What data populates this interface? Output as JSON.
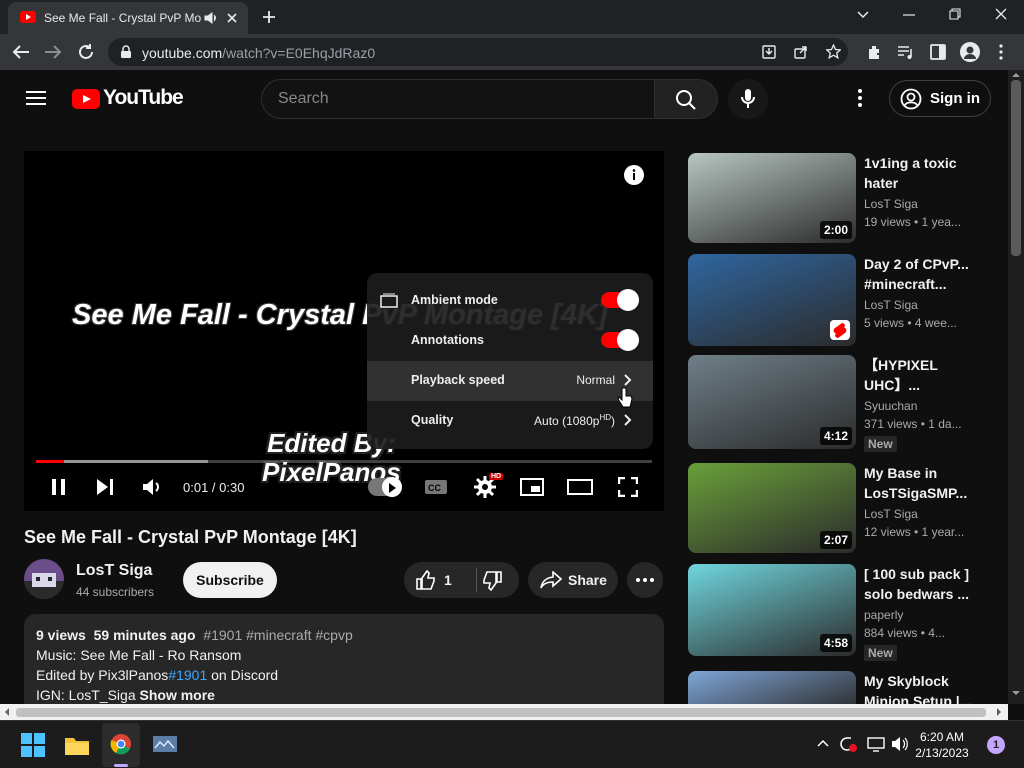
{
  "browser": {
    "tab_title": "See Me Fall - Crystal PvP Mo",
    "url_host": "youtube.com",
    "url_path": "/watch?v=E0EhqJdRaz0"
  },
  "header": {
    "logo_text": "YouTube",
    "search_placeholder": "Search",
    "signin_label": "Sign in"
  },
  "player": {
    "overlay_title": "See Me Fall - Crystal PvP Montage [4K]",
    "overlay_credit": "Edited By:\nPixelPanos",
    "time": "0:01 / 0:30",
    "progress_fraction": 0.045,
    "buffered_fraction": 0.28,
    "settings_badge": "HD",
    "settings_menu": {
      "ambient_mode_label": "Ambient mode",
      "annotations_label": "Annotations",
      "playback_speed_label": "Playback speed",
      "playback_speed_value": "Normal",
      "quality_label": "Quality",
      "quality_value": "Auto (1080p",
      "quality_badge": "HD",
      "quality_close": ")"
    }
  },
  "video": {
    "title": "See Me Fall - Crystal PvP Montage [4K]",
    "channel": "LosT Siga",
    "subscribers": "44 subscribers",
    "subscribe_label": "Subscribe",
    "like_count": "1",
    "share_label": "Share",
    "description": {
      "views": "9 views",
      "age": "59 minutes ago",
      "tags": "#1901 #minecraft #cpvp",
      "line2": "Music: See Me Fall - Ro Ransom",
      "line3_a": "Edited by Pix3lPanos",
      "line3_link": "#1901",
      "line3_b": " on Discord",
      "line4": "IGN: LosT_Siga",
      "show_more": "Show more"
    }
  },
  "sidebar": [
    {
      "title": "1v1ing a toxic hater",
      "channel": "LosT Siga",
      "meta": "19 views • 1 yea...",
      "duration": "2:00",
      "new": "",
      "thumb_color": "#b8c6c0"
    },
    {
      "title": "Day 2 of CPvP... #minecraft...",
      "channel": "LosT Siga",
      "meta": "5 views • 4 wee...",
      "duration": "",
      "new": "",
      "thumb_color": "#2f66a0"
    },
    {
      "title": "【HYPIXEL UHC】...",
      "channel": "Syuuchan",
      "meta": "371 views • 1 da...",
      "duration": "4:12",
      "new": "New",
      "thumb_color": "#6f7f88"
    },
    {
      "title": "My Base in LosTSigaSMP...",
      "channel": "LosT Siga",
      "meta": "12 views • 1 year...",
      "duration": "2:07",
      "new": "",
      "thumb_color": "#6aa03a"
    },
    {
      "title": "[ 100 sub pack ] solo bedwars ...",
      "channel": "paperly",
      "meta": "884 views • 4...",
      "duration": "4:58",
      "new": "New",
      "thumb_color": "#6fd6de"
    },
    {
      "title": "My Skyblock Minion Setup |...",
      "channel": "",
      "meta": "",
      "duration": "",
      "new": "",
      "thumb_color": "#7fa6d8"
    }
  ],
  "taskbar": {
    "time": "6:20 AM",
    "date": "2/13/2023",
    "notification_count": "1"
  },
  "colors": {
    "accent": "#ff0000",
    "link": "#3ea6ff",
    "background": "#0f0f0f"
  }
}
